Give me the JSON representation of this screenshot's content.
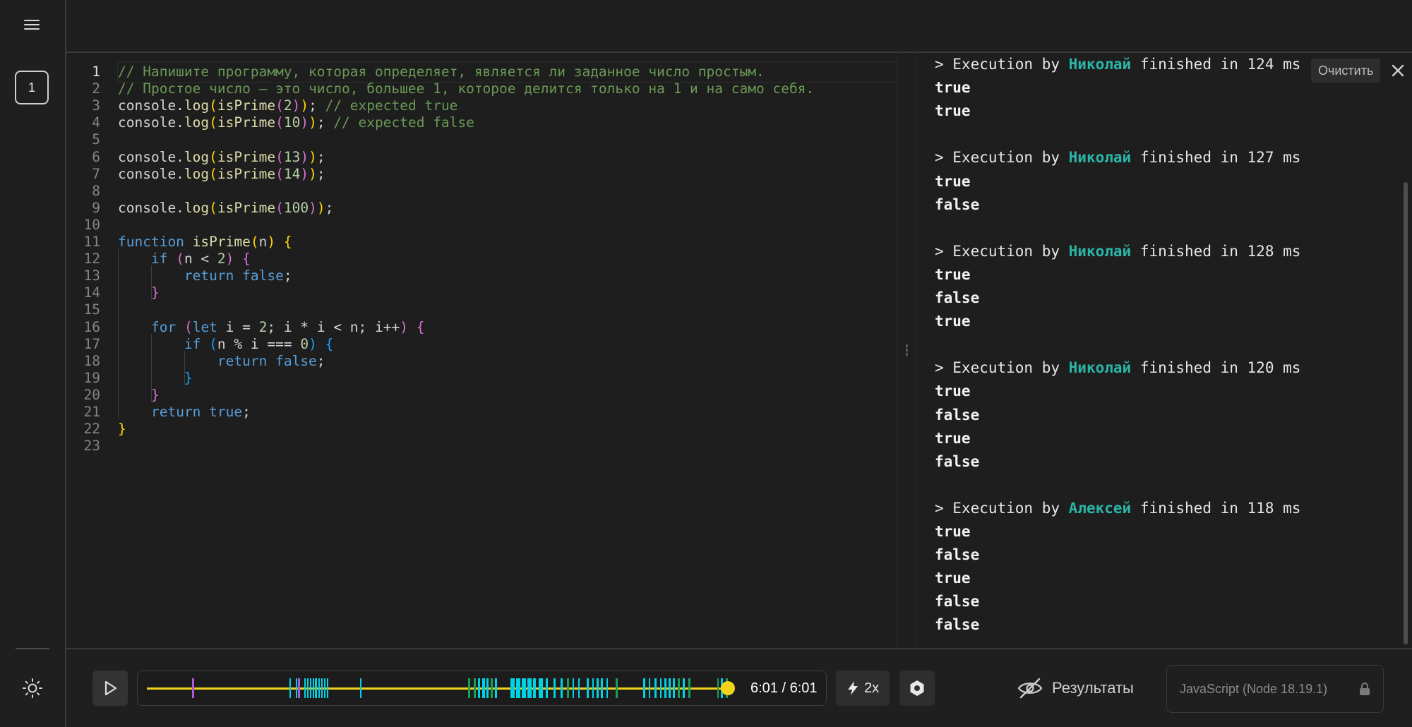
{
  "sidebar": {
    "room_number": "1",
    "icons": {
      "menu": "hamburger-menu-icon",
      "theme": "sun-icon"
    }
  },
  "editor": {
    "language": "javascript",
    "active_line": 1,
    "lines": [
      "// Напишите программу, которая определяет, является ли заданное число простым.",
      "// Простое число — это число, большее 1, которое делится только на 1 и на само себя.",
      "console.log(isPrime(2)); // expected true",
      "console.log(isPrime(10)); // expected false",
      "",
      "console.log(isPrime(13));",
      "console.log(isPrime(14));",
      "",
      "console.log(isPrime(100));",
      "",
      "function isPrime(n) {",
      "    if (n < 2) {",
      "        return false;",
      "    }",
      "",
      "    for (let i = 2; i * i < n; i++) {",
      "        if (n % i === 0) {",
      "            return false;",
      "        }",
      "    }",
      "    return true;",
      "}",
      ""
    ]
  },
  "console": {
    "clear_label": "Очистить",
    "runs": [
      {
        "prefix": "> Execution by ",
        "user": "Николай",
        "suffix": " finished in 124 ms",
        "output": [
          "true",
          "true"
        ]
      },
      {
        "prefix": "> Execution by ",
        "user": "Николай",
        "suffix": " finished in 127 ms",
        "output": [
          "true",
          "false"
        ]
      },
      {
        "prefix": "> Execution by ",
        "user": "Николай",
        "suffix": " finished in 128 ms",
        "output": [
          "true",
          "false",
          "true"
        ]
      },
      {
        "prefix": "> Execution by ",
        "user": "Николай",
        "suffix": " finished in 120 ms",
        "output": [
          "true",
          "false",
          "true",
          "false"
        ]
      },
      {
        "prefix": "> Execution by ",
        "user": "Алексей",
        "suffix": " finished in 118 ms",
        "output": [
          "true",
          "false",
          "true",
          "false",
          "false"
        ]
      }
    ]
  },
  "player": {
    "time": "6:01 / 6:01",
    "progress": 1.0,
    "speed_label": "2x",
    "results_label": "Результаты",
    "icons": {
      "play": "play-icon",
      "speed": "lightning-icon",
      "settings": "hexagon-settings-icon",
      "results": "eye-off-icon"
    }
  },
  "language_selector": {
    "value": "JavaScript (Node 18.19.1)",
    "icon": "lock-icon"
  },
  "colors": {
    "accent_yellow": "#f2d21b",
    "user_teal": "#2bb5a6",
    "mark_cyan": "#00d2e6",
    "mark_green": "#18a058",
    "mark_purple": "#b05ad8",
    "background": "#1e1e1e"
  }
}
